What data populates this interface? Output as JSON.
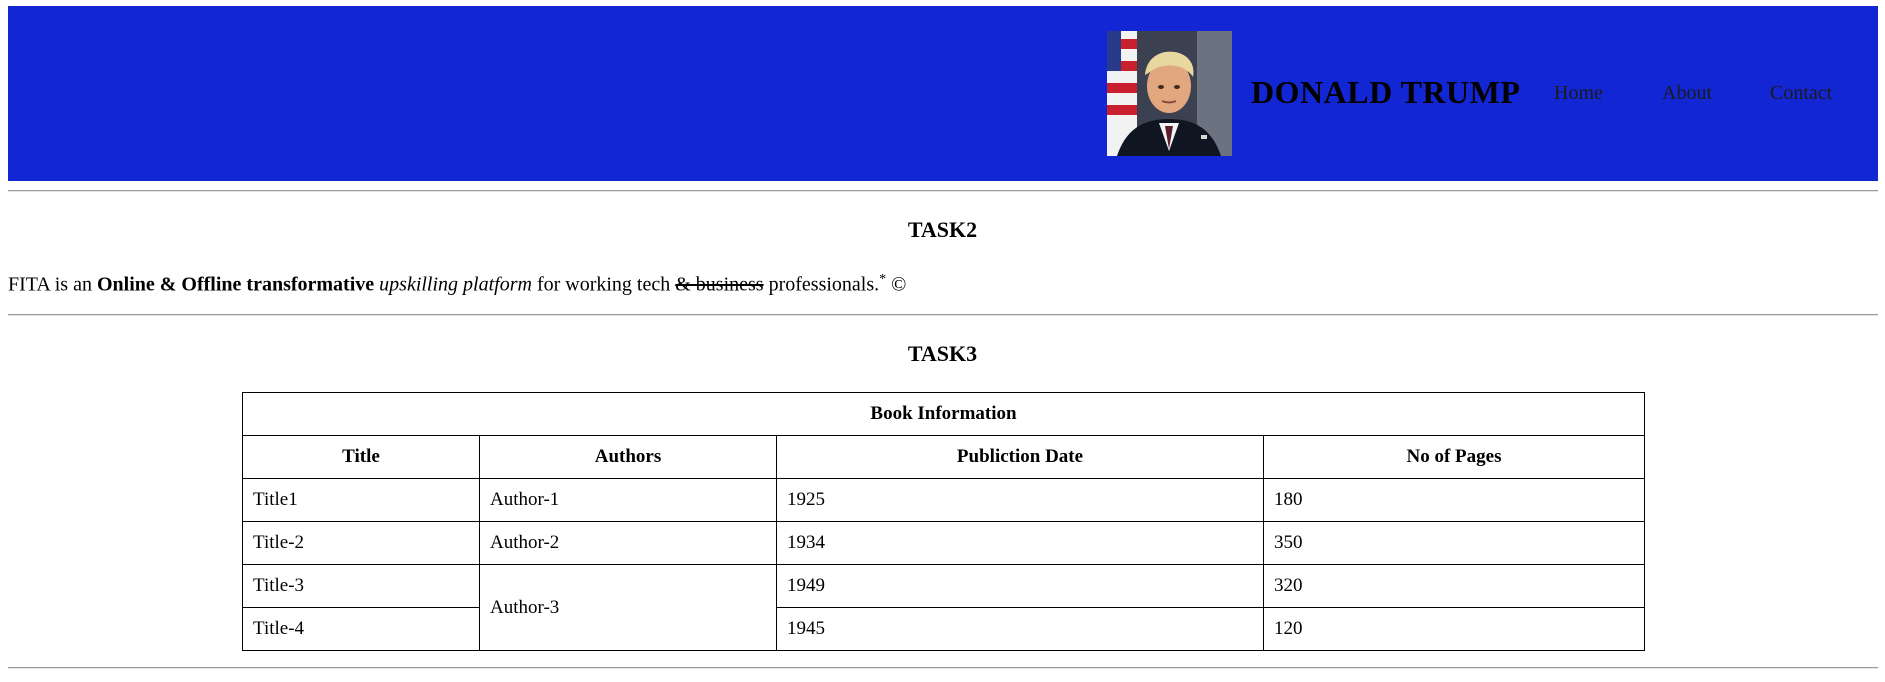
{
  "header": {
    "background": "#1326d3",
    "avatar_alt": "Donald Trump portrait",
    "brand": "DONALD TRUMP",
    "nav": [
      "Home",
      "About",
      "Contact"
    ]
  },
  "task2": {
    "title": "TASK2",
    "parts": {
      "p1": "FITA is an ",
      "bold": "Online & Offline transformative",
      "italic": "upskilling platform",
      "p2": " for working tech ",
      "struck": "& business",
      "p3": " professionals.",
      "sup": "*",
      "tail": " ©"
    }
  },
  "task3": {
    "title": "TASK3",
    "table": {
      "caption": "Book Information",
      "headers": [
        "Title",
        "Authors",
        "Publiction Date",
        "No of Pages"
      ],
      "rows": [
        {
          "title": "Title1",
          "author": "Author-1",
          "date": "1925",
          "pages": "180"
        },
        {
          "title": "Title-2",
          "author": "Author-2",
          "date": "1934",
          "pages": "350"
        },
        {
          "title": "Title-3",
          "author": "Author-3",
          "date": "1949",
          "pages": "320"
        },
        {
          "title": "Title-4",
          "author": "",
          "date": "1945",
          "pages": "120"
        }
      ]
    }
  }
}
